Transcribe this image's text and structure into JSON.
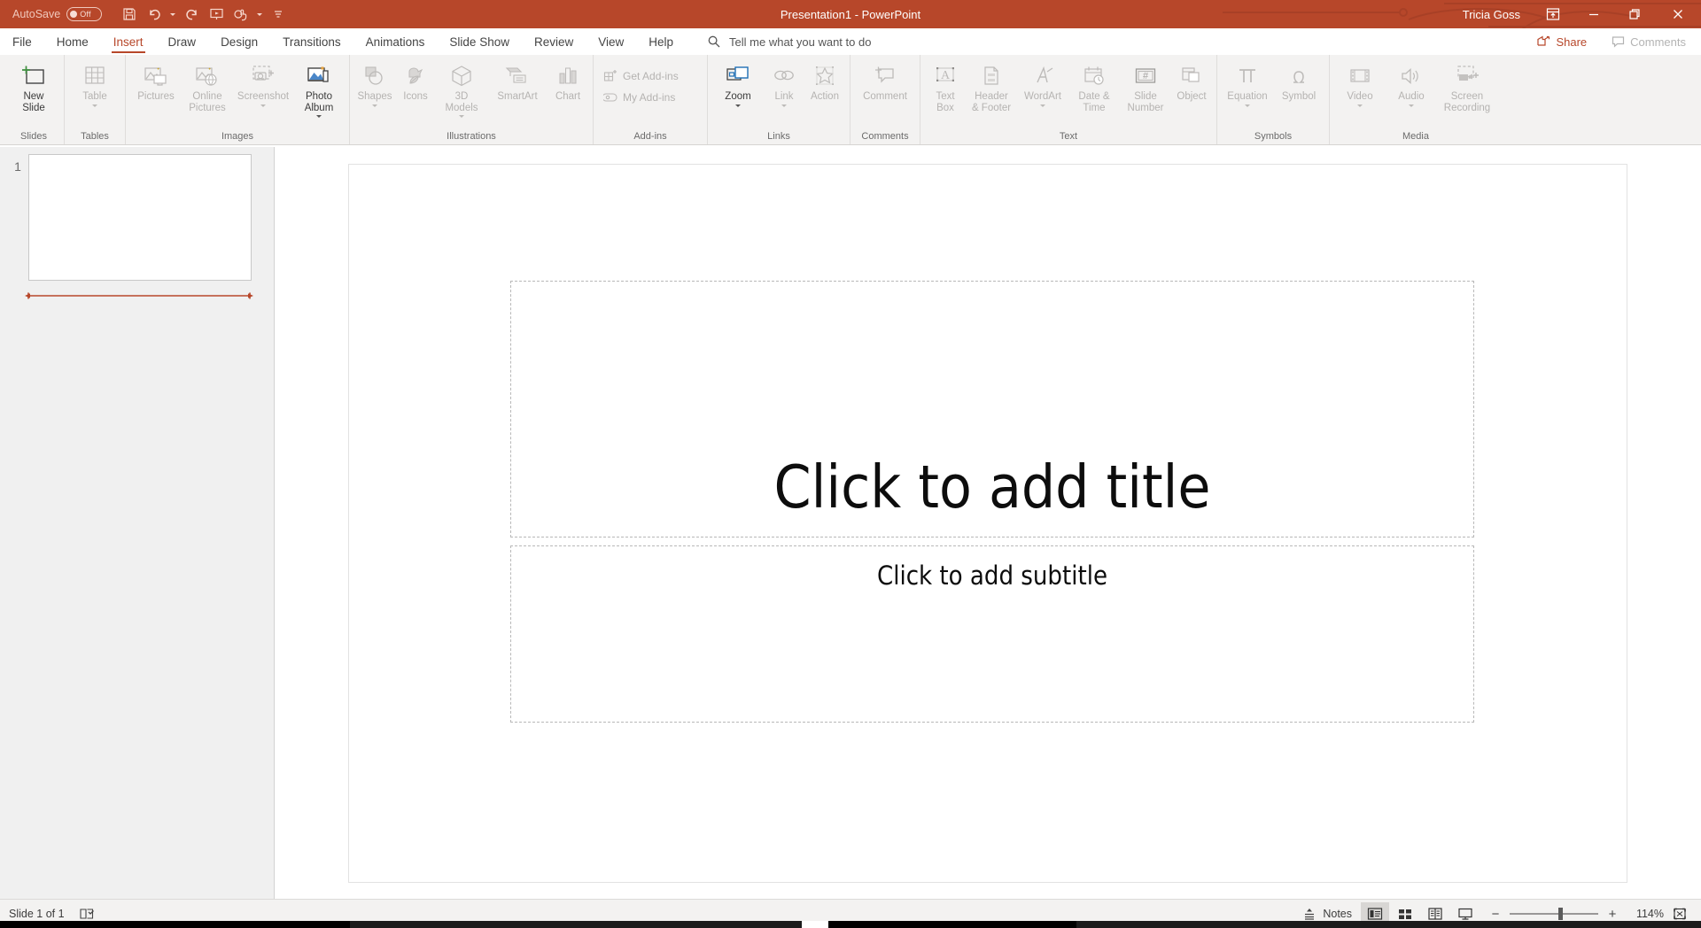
{
  "titlebar": {
    "autosave_label": "AutoSave",
    "autosave_state": "Off",
    "quick_access": [
      "save-icon",
      "undo-icon",
      "redo-icon",
      "start-slideshow-icon",
      "touch-mode-icon",
      "customize-qat-icon"
    ],
    "document_title": "Presentation1  -  PowerPoint",
    "user_name": "Tricia Goss",
    "ribbon_display_options": "ribbon-display-options-icon",
    "minimize": "minimize-icon",
    "restore": "restore-icon",
    "close": "close-icon",
    "accent_color": "#b7472a"
  },
  "tabs": [
    {
      "label": "File",
      "active": false
    },
    {
      "label": "Home",
      "active": false
    },
    {
      "label": "Insert",
      "active": true
    },
    {
      "label": "Draw",
      "active": false
    },
    {
      "label": "Design",
      "active": false
    },
    {
      "label": "Transitions",
      "active": false
    },
    {
      "label": "Animations",
      "active": false
    },
    {
      "label": "Slide Show",
      "active": false
    },
    {
      "label": "Review",
      "active": false
    },
    {
      "label": "View",
      "active": false
    },
    {
      "label": "Help",
      "active": false
    }
  ],
  "tellme": {
    "icon": "search-icon",
    "placeholder": "Tell me what you want to do"
  },
  "share": {
    "share_label": "Share",
    "comments_label": "Comments"
  },
  "ribbon": {
    "groups": [
      {
        "name": "Slides",
        "label": "Slides",
        "buttons": [
          {
            "label": "New\nSlide",
            "icon": "new-slide-icon",
            "disabled": false,
            "dropdown": true
          }
        ]
      },
      {
        "name": "Tables",
        "label": "Tables",
        "buttons": [
          {
            "label": "Table",
            "icon": "table-icon",
            "disabled": true,
            "dropdown": true
          }
        ]
      },
      {
        "name": "Images",
        "label": "Images",
        "buttons": [
          {
            "label": "Pictures",
            "icon": "pictures-icon",
            "disabled": true,
            "dropdown": false
          },
          {
            "label": "Online\nPictures",
            "icon": "online-pictures-icon",
            "disabled": true,
            "dropdown": false
          },
          {
            "label": "Screenshot",
            "icon": "screenshot-icon",
            "disabled": true,
            "dropdown": true
          },
          {
            "label": "Photo\nAlbum",
            "icon": "photo-album-icon",
            "disabled": false,
            "dropdown": true
          }
        ]
      },
      {
        "name": "Illustrations",
        "label": "Illustrations",
        "buttons": [
          {
            "label": "Shapes",
            "icon": "shapes-icon",
            "disabled": true,
            "dropdown": true
          },
          {
            "label": "Icons",
            "icon": "icons-icon",
            "disabled": true,
            "dropdown": false
          },
          {
            "label": "3D\nModels",
            "icon": "3d-models-icon",
            "disabled": true,
            "dropdown": true
          },
          {
            "label": "SmartArt",
            "icon": "smartart-icon",
            "disabled": true,
            "dropdown": false
          },
          {
            "label": "Chart",
            "icon": "chart-icon",
            "disabled": true,
            "dropdown": false
          }
        ]
      },
      {
        "name": "Add-ins",
        "label": "Add-ins",
        "rows": [
          {
            "label": "Get Add-ins",
            "icon": "get-addins-icon",
            "disabled": true,
            "dropdown": false
          },
          {
            "label": "My Add-ins",
            "icon": "my-addins-icon",
            "disabled": true,
            "dropdown": true
          }
        ]
      },
      {
        "name": "Links",
        "label": "Links",
        "buttons": [
          {
            "label": "Zoom",
            "icon": "zoom-icon",
            "disabled": false,
            "dropdown": true
          },
          {
            "label": "Link",
            "icon": "link-icon",
            "disabled": true,
            "dropdown": true
          },
          {
            "label": "Action",
            "icon": "action-icon",
            "disabled": true,
            "dropdown": false
          }
        ]
      },
      {
        "name": "Comments",
        "label": "Comments",
        "buttons": [
          {
            "label": "Comment",
            "icon": "comment-icon",
            "disabled": true,
            "dropdown": false
          }
        ]
      },
      {
        "name": "Text",
        "label": "Text",
        "buttons": [
          {
            "label": "Text\nBox",
            "icon": "text-box-icon",
            "disabled": true,
            "dropdown": false
          },
          {
            "label": "Header\n& Footer",
            "icon": "header-footer-icon",
            "disabled": true,
            "dropdown": false
          },
          {
            "label": "WordArt",
            "icon": "wordart-icon",
            "disabled": true,
            "dropdown": true
          },
          {
            "label": "Date &\nTime",
            "icon": "date-time-icon",
            "disabled": true,
            "dropdown": false
          },
          {
            "label": "Slide\nNumber",
            "icon": "slide-number-icon",
            "disabled": true,
            "dropdown": false
          },
          {
            "label": "Object",
            "icon": "object-icon",
            "disabled": true,
            "dropdown": false
          }
        ]
      },
      {
        "name": "Symbols",
        "label": "Symbols",
        "buttons": [
          {
            "label": "Equation",
            "icon": "equation-icon",
            "disabled": true,
            "dropdown": true
          },
          {
            "label": "Symbol",
            "icon": "symbol-icon",
            "disabled": true,
            "dropdown": false
          }
        ]
      },
      {
        "name": "Media",
        "label": "Media",
        "buttons": [
          {
            "label": "Video",
            "icon": "video-icon",
            "disabled": true,
            "dropdown": true
          },
          {
            "label": "Audio",
            "icon": "audio-icon",
            "disabled": true,
            "dropdown": true
          },
          {
            "label": "Screen\nRecording",
            "icon": "screen-recording-icon",
            "disabled": true,
            "dropdown": false
          }
        ]
      }
    ]
  },
  "thumbnails": [
    {
      "number": "1",
      "selected": true
    }
  ],
  "slide": {
    "title_placeholder": "Click to add title",
    "subtitle_placeholder": "Click to add subtitle"
  },
  "statusbar": {
    "slide_count": "Slide 1 of 1",
    "accessibility_icon": "accessibility-checker-icon",
    "notes_label": "Notes",
    "notes_icon": "notes-icon",
    "views": [
      {
        "name": "normal-view",
        "icon": "normal-view-icon",
        "active": true
      },
      {
        "name": "slide-sorter-view",
        "icon": "slide-sorter-icon",
        "active": false
      },
      {
        "name": "reading-view",
        "icon": "reading-view-icon",
        "active": false
      },
      {
        "name": "slide-show-view",
        "icon": "slide-show-icon",
        "active": false
      }
    ],
    "zoom_out": "−",
    "zoom_in": "+",
    "zoom_level": "114%",
    "fit_to_window": "fit-slide-to-window-icon"
  }
}
